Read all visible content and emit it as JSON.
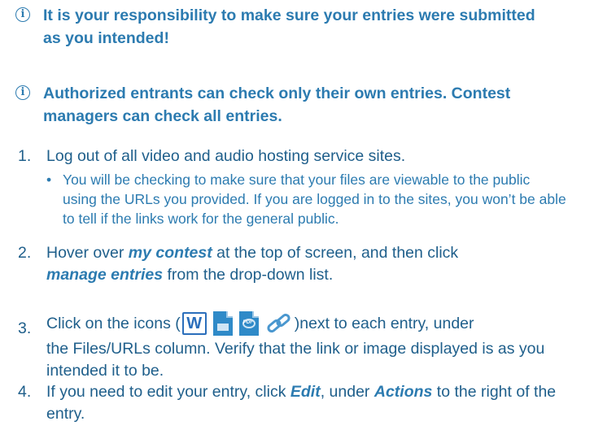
{
  "notes": [
    "It is your responsibility to make sure your entries were submitted as you intended!",
    "Authorized entrants can check only their own entries. Contest managers can check all entries."
  ],
  "steps": [
    {
      "num": "1.",
      "text": "Log out of all video and audio hosting service sites.",
      "bullet": "You will be checking to make sure that your files are viewable to the public using the URLs you provided. If you are logged in to the sites, you won’t be able to tell if the links work for the general public."
    },
    {
      "num": "2.",
      "p1": "Hover over ",
      "e1": "my contest",
      "p2": " at the top of screen, and then click",
      "e2": "manage entries",
      "p3": " from the drop-down list."
    },
    {
      "num": "3.",
      "p1": "Click on the icons (",
      "p2": ")next to each entry, under",
      "p3": "the Files/URLs column. Verify that the link or image displayed is as you intended it to be."
    },
    {
      "num": "4.",
      "p1": "If you need to edit your entry, click ",
      "e1": "Edit",
      "p2": ", under ",
      "e2": "Actions",
      "p3": " to the right of the entry."
    }
  ]
}
